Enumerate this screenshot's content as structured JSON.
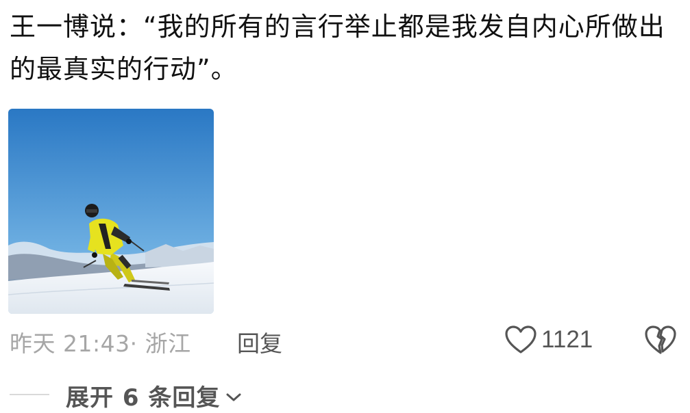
{
  "comment": {
    "text": "王一博说：“我的所有的言行举止都是我发自内心所做出的最真实的行动”。"
  },
  "photo": {
    "alt_subject": "skier",
    "colors": {
      "sky_top": "#2a78c4",
      "sky_bottom": "#8cc2ea",
      "snow": "#f3f6fa",
      "jacket": "#e6e21f"
    }
  },
  "meta": {
    "time_location": "昨天 21:43· 浙江",
    "reply_label": "回复",
    "like_icon": "heart-outline-icon",
    "like_count": "1121",
    "dislike_icon": "broken-heart-icon"
  },
  "replies": {
    "expand_label": "展开 6 条回复",
    "expand_icon": "chevron-down-icon"
  },
  "colors": {
    "text_primary": "#111111",
    "text_secondary": "#a6a6a6",
    "text_action": "#555555",
    "divider": "#d9d9d9"
  }
}
